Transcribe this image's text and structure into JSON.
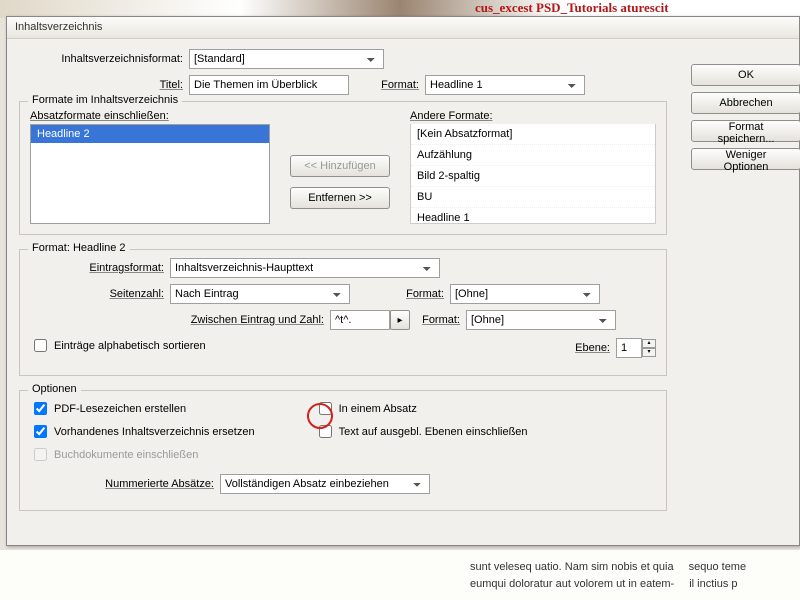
{
  "bg": {
    "topRed": "cus_excest PSD_Tutorials aturescit",
    "docText1": "sunt veleseq uatio. Nam sim nobis et quia",
    "docText2": "eumqui doloratur aut volorem ut in eatem-",
    "docRight1": "sequo teme",
    "docRight2": "il inctius p"
  },
  "dialog": {
    "title": "Inhaltsverzeichnis",
    "formatLabel": "Inhaltsverzeichnisformat:",
    "formatValue": "[Standard]",
    "titelLabel": "Titel:",
    "titelValue": "Die Themen im Überblick",
    "formatLabel2": "Format:",
    "formatValue2": "Headline 1"
  },
  "buttons": {
    "ok": "OK",
    "cancel": "Abbrechen",
    "saveFormat": "Format speichern...",
    "lessOptions": "Weniger Optionen",
    "add": "<< Hinzufügen",
    "remove": "Entfernen >>"
  },
  "group1": {
    "title": "Formate im Inhaltsverzeichnis",
    "includeLabel": "Absatzformate einschließen:",
    "otherLabel": "Andere Formate:",
    "included": [
      "Headline 2"
    ],
    "other": [
      "[Kein Absatzformat]",
      "Aufzählung",
      "Bild 2-spaltig",
      "BU",
      "Headline 1"
    ]
  },
  "group2": {
    "title": "Format: Headline 2",
    "eintragLabel": "Eintragsformat:",
    "eintragValue": "Inhaltsverzeichnis-Haupttext",
    "seitenzahlLabel": "Seitenzahl:",
    "seitenzahlValue": "Nach Eintrag",
    "zwischenLabel": "Zwischen Eintrag und Zahl:",
    "zwischenValue": "^t^.",
    "format3": "[Ohne]",
    "format4": "[Ohne]",
    "ebeneLabel": "Ebene:",
    "ebeneValue": "1",
    "sortLabel": "Einträge alphabetisch sortieren"
  },
  "group3": {
    "title": "Optionen",
    "pdfBookmarks": "PDF-Lesezeichen erstellen",
    "replace": "Vorhandenes Inhaltsverzeichnis ersetzen",
    "bookDocs": "Buchdokumente einschließen",
    "oneParagraph": "In einem Absatz",
    "hiddenLayers": "Text auf ausgebl. Ebenen einschließen",
    "numParaLabel": "Nummerierte Absätze:",
    "numParaValue": "Vollständigen Absatz einbeziehen"
  }
}
